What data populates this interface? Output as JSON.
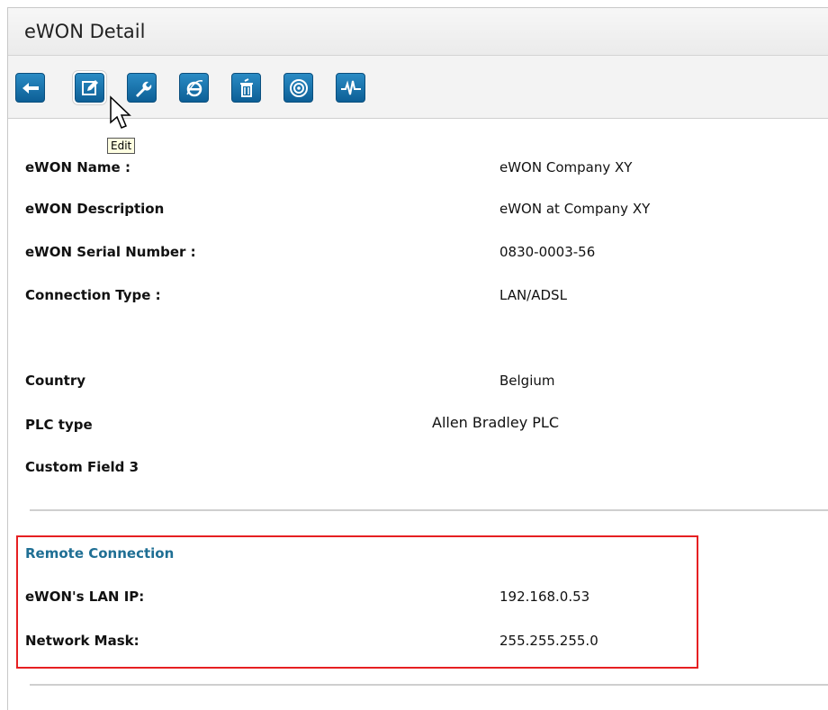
{
  "header": {
    "title": "eWON Detail"
  },
  "toolbar": {
    "buttons": [
      {
        "name": "back",
        "icon": "arrow-left-icon"
      },
      {
        "name": "edit",
        "icon": "edit-icon"
      },
      {
        "name": "settings",
        "icon": "wrench-icon"
      },
      {
        "name": "internet",
        "icon": "internet-explorer-icon"
      },
      {
        "name": "delete",
        "icon": "trash-icon"
      },
      {
        "name": "connect",
        "icon": "connect-icon"
      },
      {
        "name": "monitor",
        "icon": "heartbeat-icon"
      }
    ],
    "tooltip": "Edit"
  },
  "details": {
    "name_label": "eWON Name :",
    "name_value": "eWON Company XY",
    "description_label": "eWON Description",
    "description_value": "eWON at Company XY",
    "serial_label": "eWON Serial Number :",
    "serial_value": "0830-0003-56",
    "connection_label": "Connection Type :",
    "connection_value": "LAN/ADSL",
    "country_label": "Country",
    "country_value": "Belgium",
    "plc_label": "PLC type",
    "plc_value": "Allen Bradley PLC",
    "custom_label": "Custom Field 3",
    "custom_value": ""
  },
  "remote": {
    "title": "Remote Connection",
    "lan_ip_label": "eWON's LAN IP:",
    "lan_ip_value": "192.168.0.53",
    "mask_label": "Network Mask:",
    "mask_value": "255.255.255.0"
  },
  "colors": {
    "toolbar_button": "#1a74ad",
    "section_title": "#1f6f94",
    "highlight_border": "#e62022"
  }
}
